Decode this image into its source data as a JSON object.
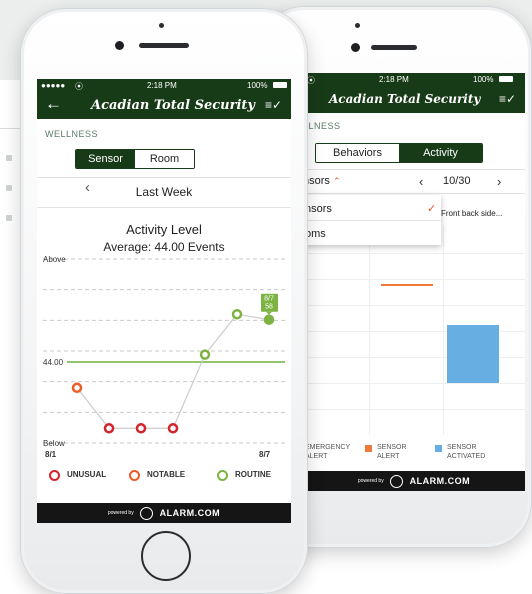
{
  "status": {
    "signal": "●●●●●",
    "wifi_icon": "wifi-icon",
    "time": "2:18 PM",
    "battery": "100%"
  },
  "brand": {
    "name": "Acadian Total Security"
  },
  "wellness": {
    "section_label": "WELLNESS",
    "tabs": [
      "Sensor",
      "Room"
    ],
    "active_tab": "Sensor"
  },
  "period": {
    "label": "Last Week"
  },
  "chart_data": {
    "type": "line",
    "title": "Activity Level",
    "subtitle": "Average: 44.00 Events",
    "y_top_label": "Above",
    "y_bottom_label": "Below",
    "baseline": 44.0,
    "baseline_label": "44.00",
    "x_start_label": "8/1",
    "x_end_label": "8/7",
    "ylim": [
      0,
      100
    ],
    "points": [
      {
        "day": "8/1",
        "value": 30,
        "status": "notable"
      },
      {
        "day": "8/2",
        "value": 8,
        "status": "unusual"
      },
      {
        "day": "8/3",
        "value": 8,
        "status": "unusual"
      },
      {
        "day": "8/4",
        "value": 8,
        "status": "unusual"
      },
      {
        "day": "8/5",
        "value": 48,
        "status": "routine"
      },
      {
        "day": "8/6",
        "value": 70,
        "status": "routine"
      },
      {
        "day": "8/7",
        "value": 67,
        "status": "routine"
      }
    ],
    "tooltip": {
      "date": "8/7",
      "value": "58"
    },
    "legend": [
      {
        "label": "UNUSUAL",
        "color": "#d3232b"
      },
      {
        "label": "NOTABLE",
        "color": "#ee5a24"
      },
      {
        "label": "ROUTINE",
        "color": "#7cb342"
      }
    ],
    "colors": {
      "baseline": "#6fb23a",
      "line": "#cccccc",
      "grid": "#c9c9c9"
    }
  },
  "back_phone": {
    "section_label": "LLNESS",
    "tabs": [
      "Behaviors",
      "Activity"
    ],
    "active_tab": "Activity",
    "filter_label": "nsors",
    "pager": "10/30",
    "dropdown": [
      "nsors",
      "oms"
    ],
    "column_label": "Front back side...",
    "legend": [
      {
        "label": "EMERGENCY ALERT",
        "color": "#d3232b"
      },
      {
        "label": "SENSOR ALERT",
        "color": "#ef7a3c"
      },
      {
        "label": "SENSOR ACTIVATED",
        "color": "#67aee3"
      }
    ]
  },
  "footer": {
    "powered_by": "powered by",
    "brand": "ALARM.COM"
  }
}
